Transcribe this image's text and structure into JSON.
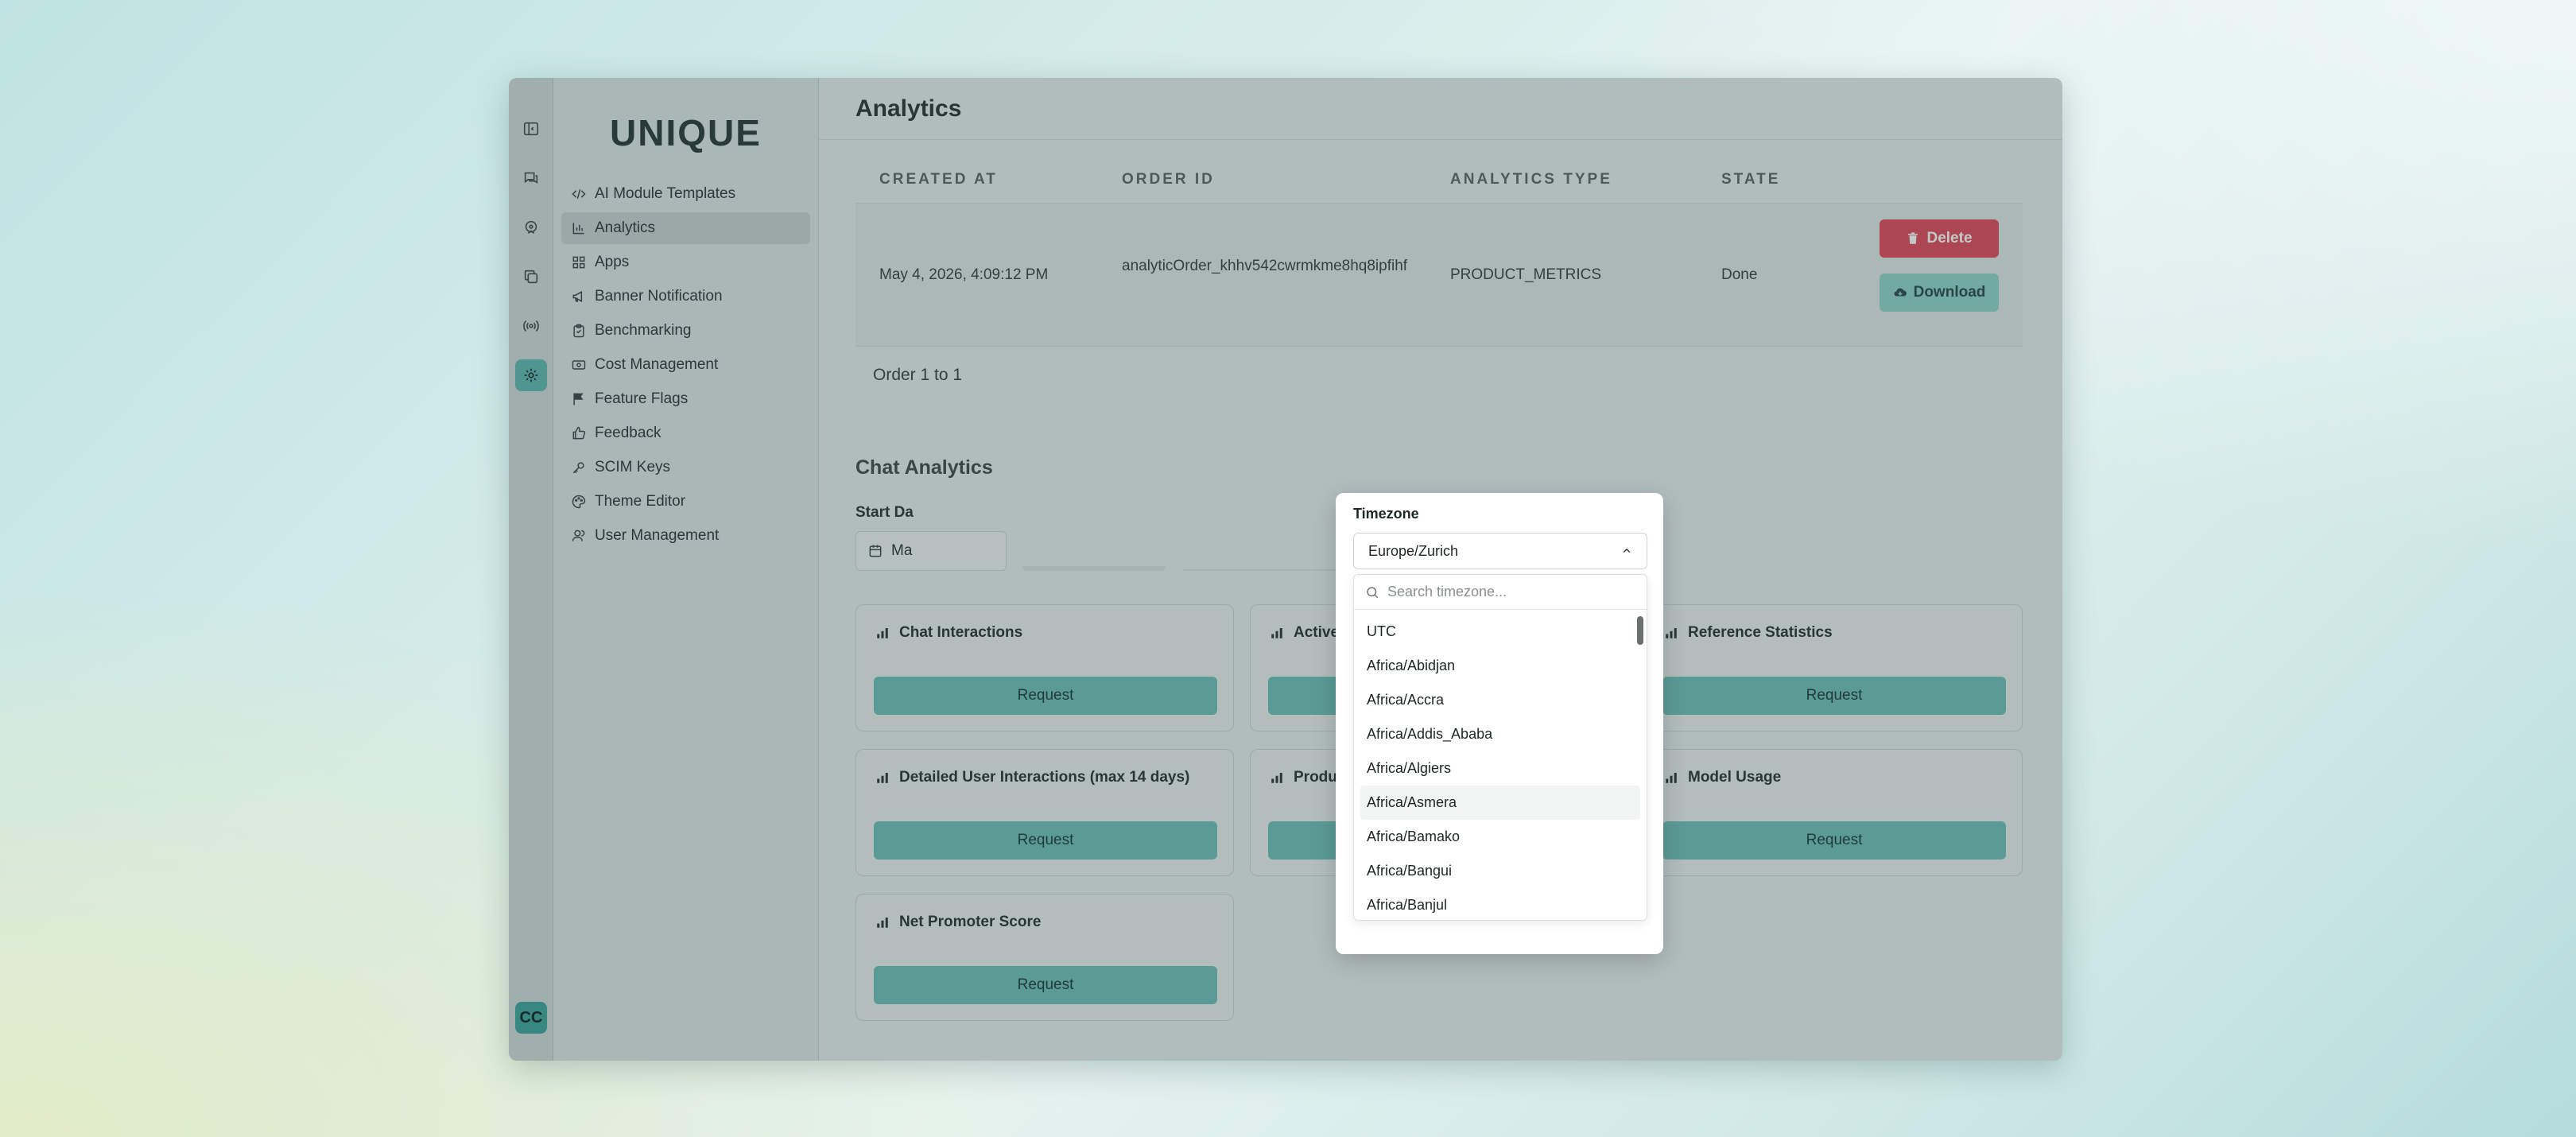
{
  "app": {
    "logo": "UNIQUE"
  },
  "header": {
    "title": "Analytics"
  },
  "rail": {
    "avatar_initials": "CC"
  },
  "sidebar": {
    "items": [
      {
        "label": "AI Module Templates",
        "icon": "code-icon"
      },
      {
        "label": "Analytics",
        "icon": "chart-icon",
        "active": true
      },
      {
        "label": "Apps",
        "icon": "grid-icon"
      },
      {
        "label": "Banner Notification",
        "icon": "megaphone-icon"
      },
      {
        "label": "Benchmarking",
        "icon": "clipboard-icon"
      },
      {
        "label": "Cost Management",
        "icon": "money-icon"
      },
      {
        "label": "Feature Flags",
        "icon": "flag-icon"
      },
      {
        "label": "Feedback",
        "icon": "thumbs-up-icon"
      },
      {
        "label": "SCIM Keys",
        "icon": "key-icon"
      },
      {
        "label": "Theme Editor",
        "icon": "palette-icon"
      },
      {
        "label": "User Management",
        "icon": "users-icon"
      }
    ]
  },
  "orders": {
    "columns": [
      "CREATED AT",
      "ORDER ID",
      "ANALYTICS TYPE",
      "STATE"
    ],
    "rows": [
      {
        "created_at": "May 4, 2026, 4:09:12 PM",
        "order_id": "analyticOrder_khhv542cwrmkme8hq8ipfihf",
        "type": "PRODUCT_METRICS",
        "state": "Done"
      }
    ],
    "delete_label": "Delete",
    "download_label": "Download",
    "pager": "Order 1 to 1"
  },
  "chat_analytics": {
    "title": "Chat Analytics",
    "start_label": "Start Da",
    "start_value": "Ma",
    "request_label": "Request",
    "cards": [
      {
        "title": "Chat Interactions"
      },
      {
        "title": "Active U"
      },
      {
        "title": "Reference Statistics"
      },
      {
        "title": "Detailed User Interactions (max 14 days)"
      },
      {
        "title": "Product"
      },
      {
        "title": "Model Usage"
      },
      {
        "title": "Net Promoter Score"
      }
    ]
  },
  "timezone_modal": {
    "label": "Timezone",
    "selected": "Europe/Zurich",
    "search_placeholder": "Search timezone...",
    "options": [
      "UTC",
      "Africa/Abidjan",
      "Africa/Accra",
      "Africa/Addis_Ababa",
      "Africa/Algiers",
      "Africa/Asmera",
      "Africa/Bamako",
      "Africa/Bangui",
      "Africa/Banjul"
    ],
    "hovered_index": 5
  },
  "colors": {
    "accent": "#5fb8b0",
    "danger": "#e04a5a",
    "download": "#8fd3cb"
  }
}
